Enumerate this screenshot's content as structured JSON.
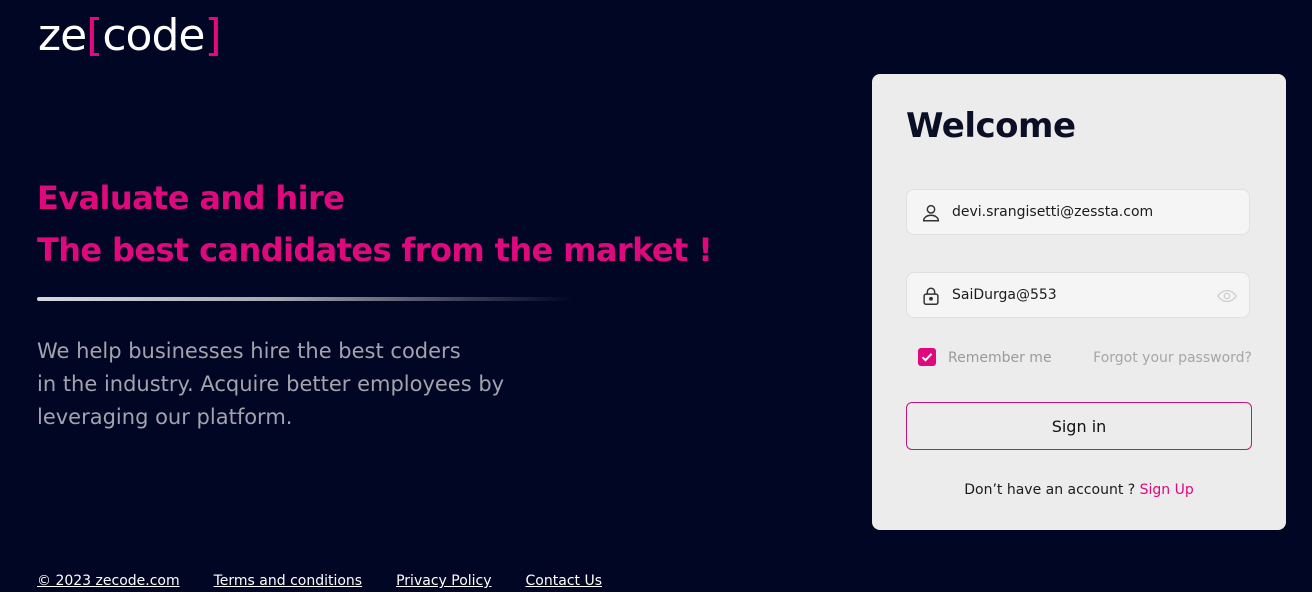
{
  "brand": {
    "logo_prefix": "ze",
    "logo_open_bracket": "[",
    "logo_word": "code",
    "logo_close_bracket": "]"
  },
  "hero": {
    "headline_line1": "Evaluate and hire",
    "headline_line2": "The best candidates from the market !",
    "description_lines": [
      "We help businesses hire the best coders",
      "in the industry. Acquire better employees by",
      "leveraging our platform."
    ]
  },
  "login": {
    "title": "Welcome",
    "email_value": "devi.srangisetti@zessta.com",
    "password_value": "SaiDurga@553",
    "remember_label": "Remember me",
    "remember_checked": true,
    "forgot_label": "Forgot your password?",
    "signin_label": "Sign in",
    "no_account_text": "Don’t have an account ?",
    "signup_label": "Sign Up"
  },
  "footer": {
    "links": [
      "© 2023 zecode.com",
      "Terms and conditions",
      "Privacy Policy",
      "Contact Us"
    ]
  },
  "colors": {
    "background": "#000624",
    "accent": "#e0087d",
    "card": "#ececec"
  }
}
